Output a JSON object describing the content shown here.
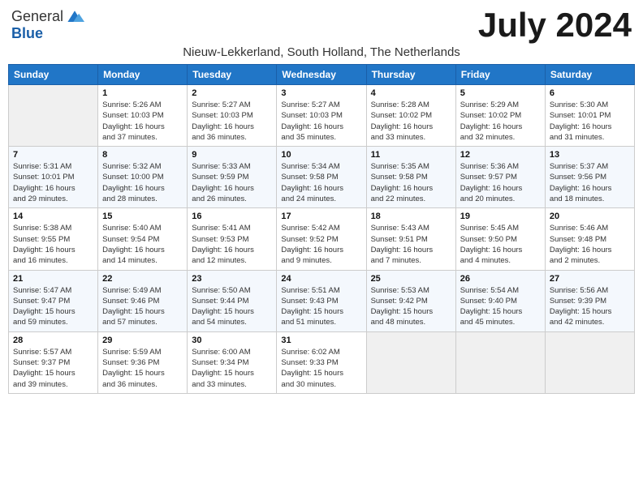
{
  "header": {
    "logo_general": "General",
    "logo_blue": "Blue",
    "month_title": "July 2024",
    "subtitle": "Nieuw-Lekkerland, South Holland, The Netherlands"
  },
  "columns": [
    "Sunday",
    "Monday",
    "Tuesday",
    "Wednesday",
    "Thursday",
    "Friday",
    "Saturday"
  ],
  "weeks": [
    [
      {
        "day": "",
        "info": ""
      },
      {
        "day": "1",
        "info": "Sunrise: 5:26 AM\nSunset: 10:03 PM\nDaylight: 16 hours\nand 37 minutes."
      },
      {
        "day": "2",
        "info": "Sunrise: 5:27 AM\nSunset: 10:03 PM\nDaylight: 16 hours\nand 36 minutes."
      },
      {
        "day": "3",
        "info": "Sunrise: 5:27 AM\nSunset: 10:03 PM\nDaylight: 16 hours\nand 35 minutes."
      },
      {
        "day": "4",
        "info": "Sunrise: 5:28 AM\nSunset: 10:02 PM\nDaylight: 16 hours\nand 33 minutes."
      },
      {
        "day": "5",
        "info": "Sunrise: 5:29 AM\nSunset: 10:02 PM\nDaylight: 16 hours\nand 32 minutes."
      },
      {
        "day": "6",
        "info": "Sunrise: 5:30 AM\nSunset: 10:01 PM\nDaylight: 16 hours\nand 31 minutes."
      }
    ],
    [
      {
        "day": "7",
        "info": "Sunrise: 5:31 AM\nSunset: 10:01 PM\nDaylight: 16 hours\nand 29 minutes."
      },
      {
        "day": "8",
        "info": "Sunrise: 5:32 AM\nSunset: 10:00 PM\nDaylight: 16 hours\nand 28 minutes."
      },
      {
        "day": "9",
        "info": "Sunrise: 5:33 AM\nSunset: 9:59 PM\nDaylight: 16 hours\nand 26 minutes."
      },
      {
        "day": "10",
        "info": "Sunrise: 5:34 AM\nSunset: 9:58 PM\nDaylight: 16 hours\nand 24 minutes."
      },
      {
        "day": "11",
        "info": "Sunrise: 5:35 AM\nSunset: 9:58 PM\nDaylight: 16 hours\nand 22 minutes."
      },
      {
        "day": "12",
        "info": "Sunrise: 5:36 AM\nSunset: 9:57 PM\nDaylight: 16 hours\nand 20 minutes."
      },
      {
        "day": "13",
        "info": "Sunrise: 5:37 AM\nSunset: 9:56 PM\nDaylight: 16 hours\nand 18 minutes."
      }
    ],
    [
      {
        "day": "14",
        "info": "Sunrise: 5:38 AM\nSunset: 9:55 PM\nDaylight: 16 hours\nand 16 minutes."
      },
      {
        "day": "15",
        "info": "Sunrise: 5:40 AM\nSunset: 9:54 PM\nDaylight: 16 hours\nand 14 minutes."
      },
      {
        "day": "16",
        "info": "Sunrise: 5:41 AM\nSunset: 9:53 PM\nDaylight: 16 hours\nand 12 minutes."
      },
      {
        "day": "17",
        "info": "Sunrise: 5:42 AM\nSunset: 9:52 PM\nDaylight: 16 hours\nand 9 minutes."
      },
      {
        "day": "18",
        "info": "Sunrise: 5:43 AM\nSunset: 9:51 PM\nDaylight: 16 hours\nand 7 minutes."
      },
      {
        "day": "19",
        "info": "Sunrise: 5:45 AM\nSunset: 9:50 PM\nDaylight: 16 hours\nand 4 minutes."
      },
      {
        "day": "20",
        "info": "Sunrise: 5:46 AM\nSunset: 9:48 PM\nDaylight: 16 hours\nand 2 minutes."
      }
    ],
    [
      {
        "day": "21",
        "info": "Sunrise: 5:47 AM\nSunset: 9:47 PM\nDaylight: 15 hours\nand 59 minutes."
      },
      {
        "day": "22",
        "info": "Sunrise: 5:49 AM\nSunset: 9:46 PM\nDaylight: 15 hours\nand 57 minutes."
      },
      {
        "day": "23",
        "info": "Sunrise: 5:50 AM\nSunset: 9:44 PM\nDaylight: 15 hours\nand 54 minutes."
      },
      {
        "day": "24",
        "info": "Sunrise: 5:51 AM\nSunset: 9:43 PM\nDaylight: 15 hours\nand 51 minutes."
      },
      {
        "day": "25",
        "info": "Sunrise: 5:53 AM\nSunset: 9:42 PM\nDaylight: 15 hours\nand 48 minutes."
      },
      {
        "day": "26",
        "info": "Sunrise: 5:54 AM\nSunset: 9:40 PM\nDaylight: 15 hours\nand 45 minutes."
      },
      {
        "day": "27",
        "info": "Sunrise: 5:56 AM\nSunset: 9:39 PM\nDaylight: 15 hours\nand 42 minutes."
      }
    ],
    [
      {
        "day": "28",
        "info": "Sunrise: 5:57 AM\nSunset: 9:37 PM\nDaylight: 15 hours\nand 39 minutes."
      },
      {
        "day": "29",
        "info": "Sunrise: 5:59 AM\nSunset: 9:36 PM\nDaylight: 15 hours\nand 36 minutes."
      },
      {
        "day": "30",
        "info": "Sunrise: 6:00 AM\nSunset: 9:34 PM\nDaylight: 15 hours\nand 33 minutes."
      },
      {
        "day": "31",
        "info": "Sunrise: 6:02 AM\nSunset: 9:33 PM\nDaylight: 15 hours\nand 30 minutes."
      },
      {
        "day": "",
        "info": ""
      },
      {
        "day": "",
        "info": ""
      },
      {
        "day": "",
        "info": ""
      }
    ]
  ]
}
